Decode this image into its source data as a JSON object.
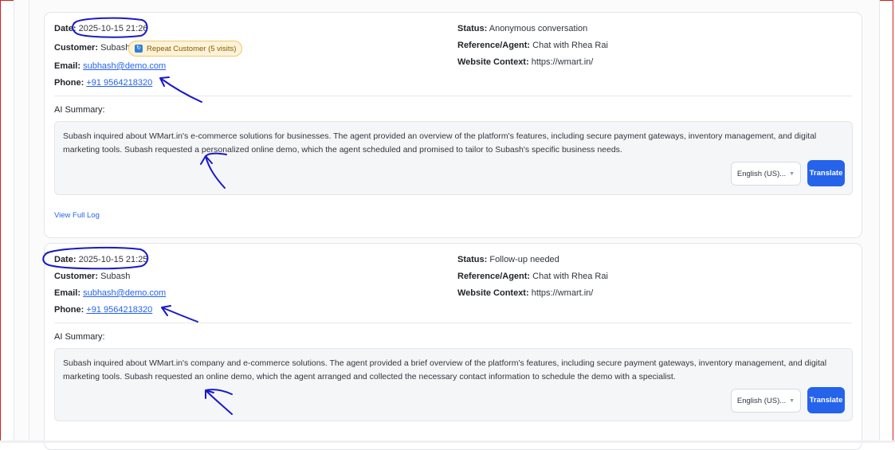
{
  "cards": [
    {
      "date_label": "Date:",
      "date": "2025-10-15 21:26",
      "customer_label": "Customer:",
      "customer": "Subash",
      "badge": "Repeat Customer (5 visits)",
      "email_label": "Email:",
      "email": "subhash@demo.com",
      "phone_label": "Phone:",
      "phone": "+91 9564218320",
      "status_label": "Status:",
      "status": "Anonymous conversation",
      "agent_label": "Reference/Agent:",
      "agent": "Chat with Rhea Rai",
      "website_label": "Website Context:",
      "website": "https://wmart.in/",
      "summary_label": "AI Summary:",
      "summary": "Subash inquired about WMart.in's e-commerce solutions for businesses. The agent provided an overview of the platform's features, including secure payment gateways, inventory management, and digital marketing tools. Subash requested a personalized online demo, which the agent scheduled and promised to tailor to Subash's specific business needs.",
      "language": "English (US)...",
      "translate": "Translate",
      "view_log": "View Full Log"
    },
    {
      "date_label": "Date:",
      "date": "2025-10-15 21:25",
      "customer_label": "Customer:",
      "customer": "Subash",
      "email_label": "Email:",
      "email": "subhash@demo.com",
      "phone_label": "Phone:",
      "phone": "+91 9564218320",
      "status_label": "Status:",
      "status": "Follow-up needed",
      "agent_label": "Reference/Agent:",
      "agent": "Chat with Rhea Rai",
      "website_label": "Website Context:",
      "website": "https://wmart.in/",
      "summary_label": "AI Summary:",
      "summary": "Subash inquired about WMart.in's company and e-commerce solutions. The agent provided a brief overview of the platform's features, including secure payment gateways, inventory management, and digital marketing tools. Subash requested an online demo, which the agent arranged and collected the necessary contact information to schedule the demo with a specialist.",
      "language": "English (US)...",
      "translate": "Translate"
    }
  ],
  "colors": {
    "accent": "#2563eb",
    "badge_bg": "#fdf3d8",
    "annotation_ink": "#1a1ac8",
    "frame_border": "#d21f1f"
  },
  "icons": {
    "badge_icon": "repeat-customer-icon",
    "select_chevron": "chevron-down-icon"
  }
}
